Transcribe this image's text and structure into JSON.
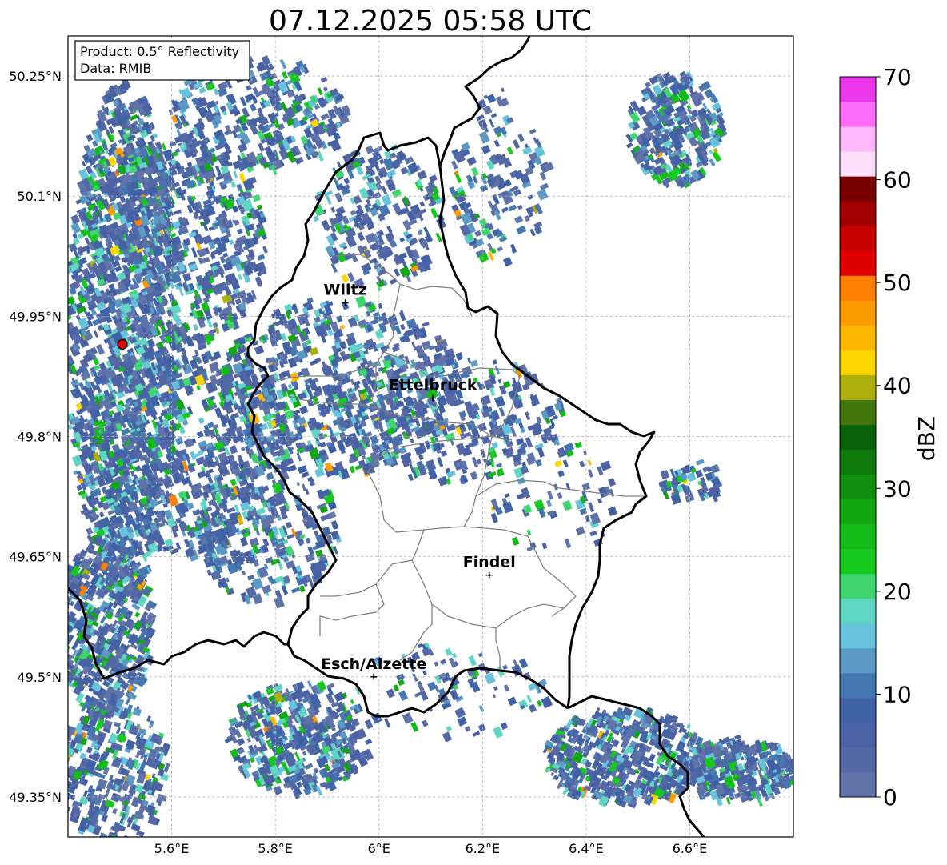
{
  "title": "07.12.2025 05:58 UTC",
  "info_box": {
    "line1": "Product: 0.5° Reflectivity",
    "line2": "Data: RMIB"
  },
  "map": {
    "lon_range": [
      5.4,
      6.8
    ],
    "lat_range": [
      49.3,
      50.3
    ],
    "x_ticks": [
      {
        "value": 5.6,
        "label": "5.6°E"
      },
      {
        "value": 5.8,
        "label": "5.8°E"
      },
      {
        "value": 6.0,
        "label": "6°E"
      },
      {
        "value": 6.2,
        "label": "6.2°E"
      },
      {
        "value": 6.4,
        "label": "6.4°E"
      },
      {
        "value": 6.6,
        "label": "6.6°E"
      }
    ],
    "y_ticks": [
      {
        "value": 50.25,
        "label": "50.25°N"
      },
      {
        "value": 50.1,
        "label": "50.1°N"
      },
      {
        "value": 49.95,
        "label": "49.95°N"
      },
      {
        "value": 49.8,
        "label": "49.8°N"
      },
      {
        "value": 49.65,
        "label": "49.65°N"
      },
      {
        "value": 49.5,
        "label": "49.5°N"
      },
      {
        "value": 49.35,
        "label": "49.35°N"
      }
    ],
    "grid": true,
    "radar_site": {
      "lon": 5.505,
      "lat": 49.915,
      "color": "#e00000"
    },
    "cities": [
      {
        "name": "Wiltz",
        "lon": 5.935,
        "lat": 49.967
      },
      {
        "name": "Ettelbruck",
        "lon": 6.104,
        "lat": 49.848
      },
      {
        "name": "Findel",
        "lon": 6.213,
        "lat": 49.627
      },
      {
        "name": "Esch/Alzette",
        "lon": 5.99,
        "lat": 49.5
      }
    ]
  },
  "colorbar": {
    "label": "dBZ",
    "min": 0,
    "max": 70,
    "step": 2.5,
    "ticks": [
      "0",
      "10",
      "20",
      "30",
      "40",
      "50",
      "60",
      "70"
    ],
    "colors": [
      "#6174a9",
      "#5468a6",
      "#4b63a5",
      "#4262a6",
      "#4577b1",
      "#5a9ac5",
      "#66c3db",
      "#5fd6c3",
      "#3fd66f",
      "#15c91d",
      "#12bb15",
      "#12a811",
      "#128f11",
      "#0e7a0c",
      "#0a620a",
      "#43760c",
      "#adb00a",
      "#fcd600",
      "#fdb700",
      "#fd9c00",
      "#ff7f00",
      "#e00000",
      "#c80000",
      "#a00000",
      "#7a0000",
      "#ffe0fc",
      "#ffb8fc",
      "#ff6cf8",
      "#ea38ea"
    ]
  }
}
